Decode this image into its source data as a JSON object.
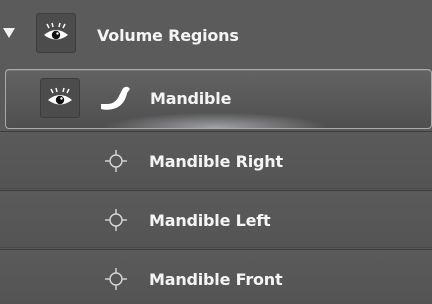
{
  "group": {
    "label": "Volume Regions",
    "expanded": true,
    "expander_icon": "caret-down-icon",
    "visibility_icon": "eye-icon"
  },
  "items": [
    {
      "label": "Mandible",
      "icon": "mandible-shape-icon",
      "visibility_icon": "eye-icon",
      "selected": true
    },
    {
      "label": "Mandible Right",
      "icon": "crosshair-point-icon",
      "selected": false
    },
    {
      "label": "Mandible Left",
      "icon": "crosshair-point-icon",
      "selected": false
    },
    {
      "label": "Mandible Front",
      "icon": "crosshair-point-icon",
      "selected": false
    }
  ],
  "colors": {
    "text": "#f4f4f4",
    "background": "#5a5a5a",
    "selected_border": "#a9a9a9"
  }
}
